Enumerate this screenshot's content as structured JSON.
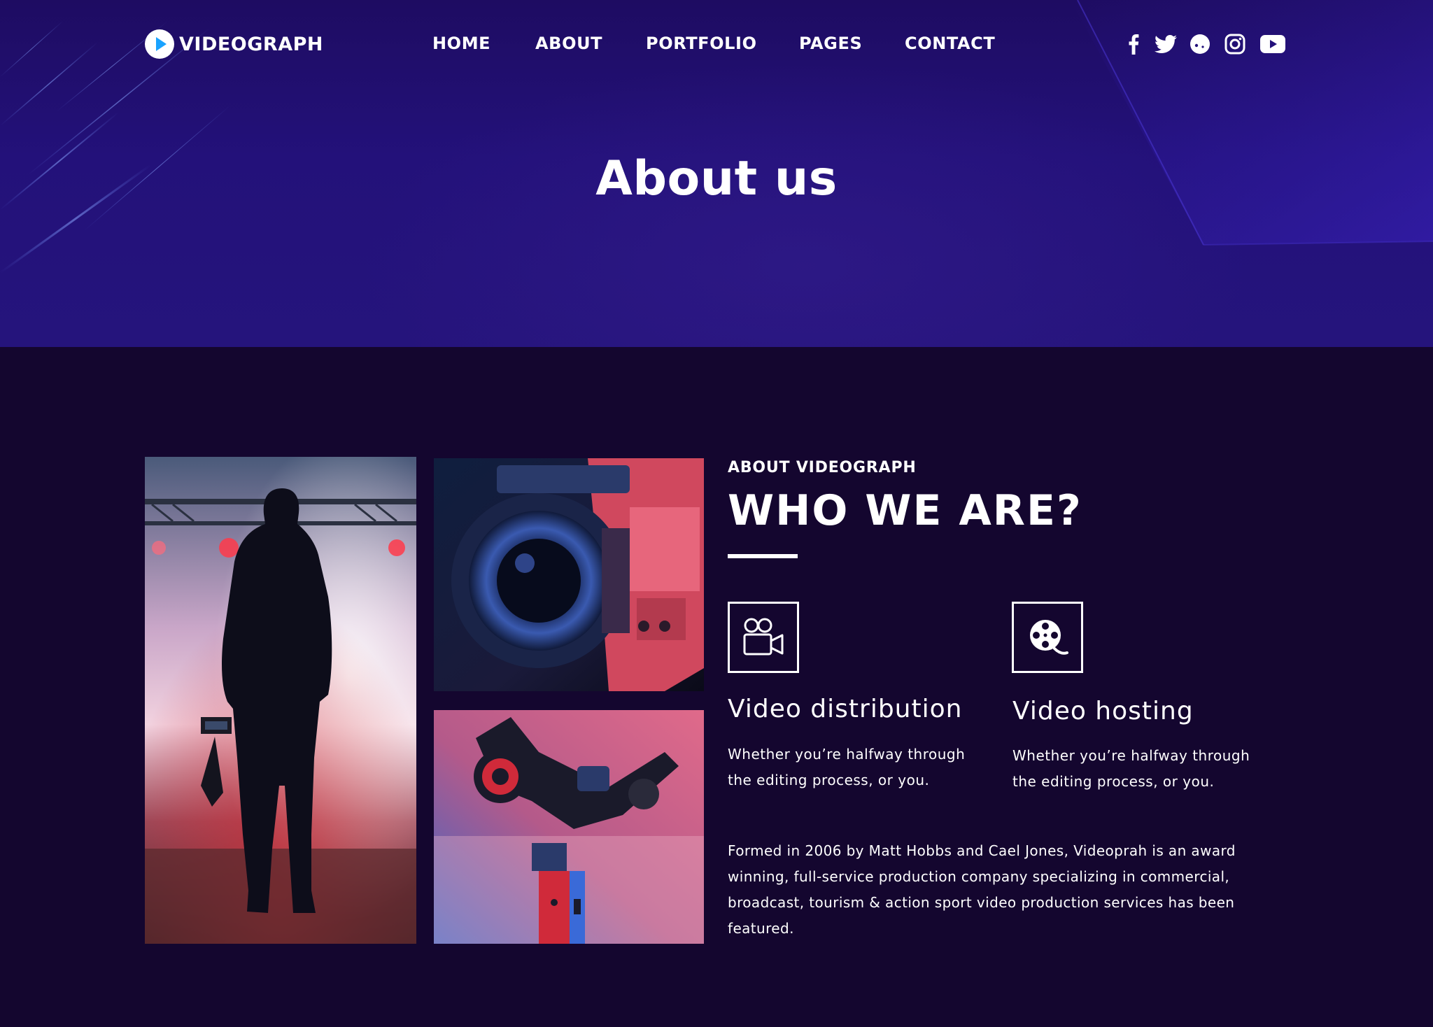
{
  "brand": {
    "name": "VIDEOGRAPH",
    "accent": "#1aa3ff"
  },
  "nav": {
    "items": [
      {
        "label": "HOME"
      },
      {
        "label": "ABOUT"
      },
      {
        "label": "PORTFOLIO"
      },
      {
        "label": "PAGES"
      },
      {
        "label": "CONTACT"
      }
    ]
  },
  "social": {
    "icons": [
      "facebook-icon",
      "twitter-icon",
      "chat-bubble-icon",
      "instagram-icon",
      "youtube-icon"
    ]
  },
  "hero": {
    "title": "About us"
  },
  "about": {
    "eyebrow": "ABOUT VIDEOGRAPH",
    "title": "WHO WE ARE?",
    "features": [
      {
        "icon": "video-camera-icon",
        "title": "Video distribution",
        "text": "Whether you’re halfway through the editing process, or you."
      },
      {
        "icon": "film-reel-icon",
        "title": "Video hosting",
        "text": "Whether you’re halfway through the editing process, or you."
      }
    ],
    "body": "Formed in 2006 by Matt Hobbs and Cael Jones, Videoprah is an award winning, full-service production company specializing in commercial, broadcast, tourism & action sport video production services has been featured."
  },
  "photos": [
    {
      "subject": "camera-operator-silhouette-stage"
    },
    {
      "subject": "camera-lens-closeup"
    },
    {
      "subject": "camera-gimbal-stabilizer"
    }
  ],
  "colors": {
    "hero_bg": "#22107a",
    "page_bg": "#14062f",
    "text": "#ffffff"
  }
}
